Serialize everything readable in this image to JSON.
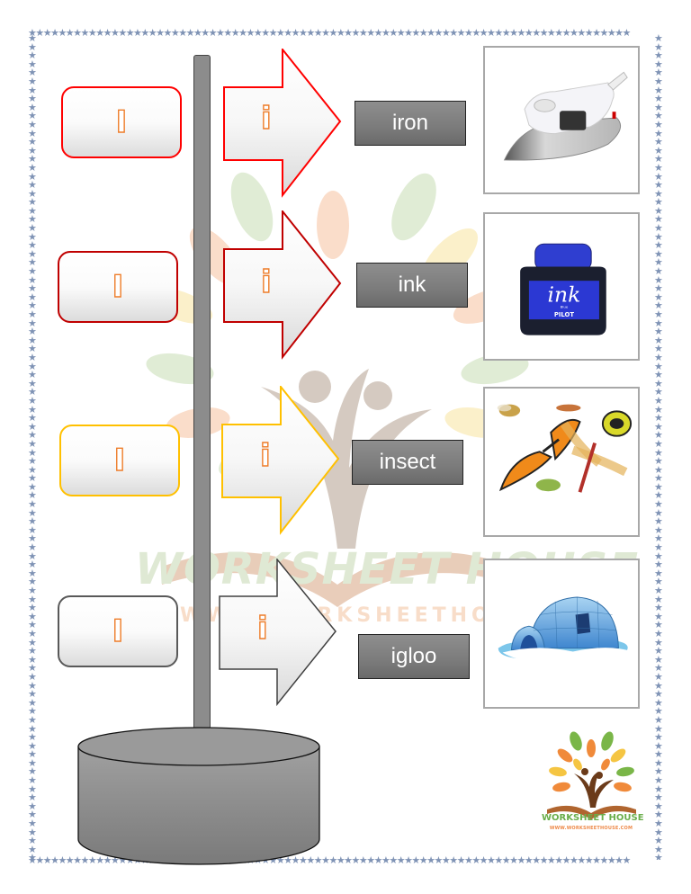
{
  "worksheet": {
    "rows": [
      {
        "capital_letter": "I",
        "lowercase_letter": "i",
        "word": "iron",
        "picture": "iron-appliance",
        "border_color": "#ff0000"
      },
      {
        "capital_letter": "I",
        "lowercase_letter": "i",
        "word": "ink",
        "picture": "ink-bottle",
        "border_color": "#c00000"
      },
      {
        "capital_letter": "I",
        "lowercase_letter": "i",
        "word": "insect",
        "picture": "insects",
        "border_color": "#ffc000"
      },
      {
        "capital_letter": "I",
        "lowercase_letter": "i",
        "word": "igloo",
        "picture": "igloo",
        "border_color": "#595959"
      }
    ],
    "letter_color": "#ee7d2a",
    "ink_label": "ink",
    "ink_sublabel": "Blue",
    "ink_brand": "PILOT"
  },
  "watermark": {
    "title": "WORKSHEET HOUSE",
    "url": "WWW.WORKSHEETHOUSE.COM"
  },
  "logo": {
    "title": "WORKSHEET HOUSE",
    "url": "WWW.WORKSHEETHOUSE.COM"
  },
  "border": {
    "star": "★",
    "color": "#7f93b5"
  }
}
